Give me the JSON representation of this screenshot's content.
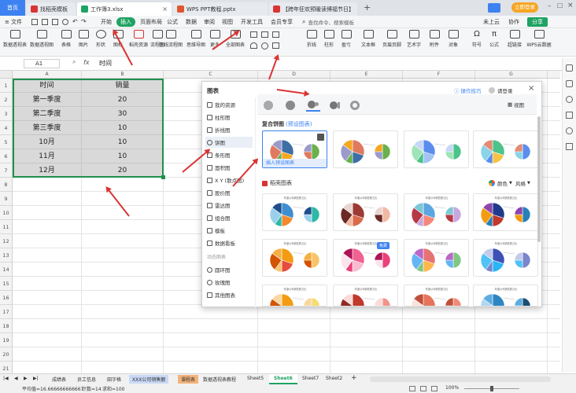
{
  "titlebar": {
    "home": "首页",
    "tabs": [
      {
        "label": "找稻壳模板",
        "color": "#d93434"
      },
      {
        "label": "工作簿3.xlsx",
        "color": "#1ea362"
      },
      {
        "label": "WPS PPT教程.pptx",
        "color": "#e0562c"
      },
      {
        "label": "【跨年狂欢预暖读博福节日】",
        "color": "#d93434"
      }
    ],
    "new_tab": "+",
    "cloud": "立即登录"
  },
  "menubar": {
    "file": "≡ 文件",
    "items": [
      "开始",
      "插入",
      "页面布局",
      "公式",
      "数据",
      "审阅",
      "视图",
      "开发工具",
      "会员专享"
    ],
    "search": "查找命令、搜索模板",
    "right": [
      "未上云",
      "协作",
      "分享"
    ]
  },
  "ribbon": {
    "buttons": [
      "数据透视表",
      "数据透视图",
      "表格",
      "图片",
      "形状",
      "图标",
      "稻壳资源",
      "流程图",
      "在线流程图",
      "思维导图",
      "在线脑图",
      "更多",
      "全部图表",
      "折线",
      "柱形",
      "盈亏",
      "文本框",
      "页眉页脚",
      "艺术字",
      "附件",
      "对象",
      "符号",
      "公式",
      "超链接",
      "WPS云数据"
    ]
  },
  "formulabar": {
    "namebox": "A1",
    "fx": "fx",
    "value": "时间"
  },
  "sheet": {
    "columns": [
      "A",
      "B",
      "C",
      "D",
      "E",
      "F",
      "G",
      "H"
    ],
    "rows": [
      "1",
      "2",
      "3",
      "4",
      "5",
      "6",
      "7",
      "8",
      "9",
      "10",
      "11",
      "12",
      "13",
      "14",
      "15",
      "16",
      "17",
      "18",
      "19",
      "20",
      "21"
    ],
    "header": [
      "时间",
      "销量"
    ],
    "data": [
      [
        "第一季度",
        "20"
      ],
      [
        "第二季度",
        "30"
      ],
      [
        "第三季度",
        "10"
      ],
      [
        "10月",
        "10"
      ],
      [
        "11月",
        "10"
      ],
      [
        "12月",
        "20"
      ]
    ]
  },
  "dialog": {
    "title": "图表",
    "help": "操作技巧",
    "login": "请登录",
    "view": "视图",
    "categories": [
      "我的资源",
      "柱形图",
      "折线图",
      "饼图",
      "条形图",
      "面积图",
      "X Y (散点图)",
      "股价图",
      "雷达图",
      "组合图",
      "模板",
      "数据看板"
    ],
    "section_dynamic": "动态图表",
    "dynamic": [
      "圆环图",
      "玫瑰图",
      "其他图表"
    ],
    "composite_title": "复合饼图",
    "composite_sub": "(预设图表)",
    "insert_label": "插入预设图表",
    "docer_title": "稻壳图表",
    "color_label": "颜色",
    "style_label": "风格",
    "free_badge": "免费",
    "thumb_caption": "年度公司销售额占比"
  },
  "sheets": {
    "nav": [
      "|◀",
      "◀",
      "▶",
      "▶|"
    ],
    "tabs": [
      "成绩表",
      "员工信息",
      "田字格",
      "XXX公司销售额",
      "课程表",
      "数据透视表教程",
      "Sheet5",
      "Sheet6",
      "Sheet7",
      "Sheet2"
    ],
    "active": "Sheet6",
    "add": "+"
  },
  "status": {
    "avg": "平均值=16.666666666667",
    "count": "计数=14",
    "sum": "求和=100",
    "zoom": "100%"
  },
  "colors": {
    "accent": "#1ea362",
    "selection": "#1f8f4e",
    "arrow": "#d93434"
  }
}
